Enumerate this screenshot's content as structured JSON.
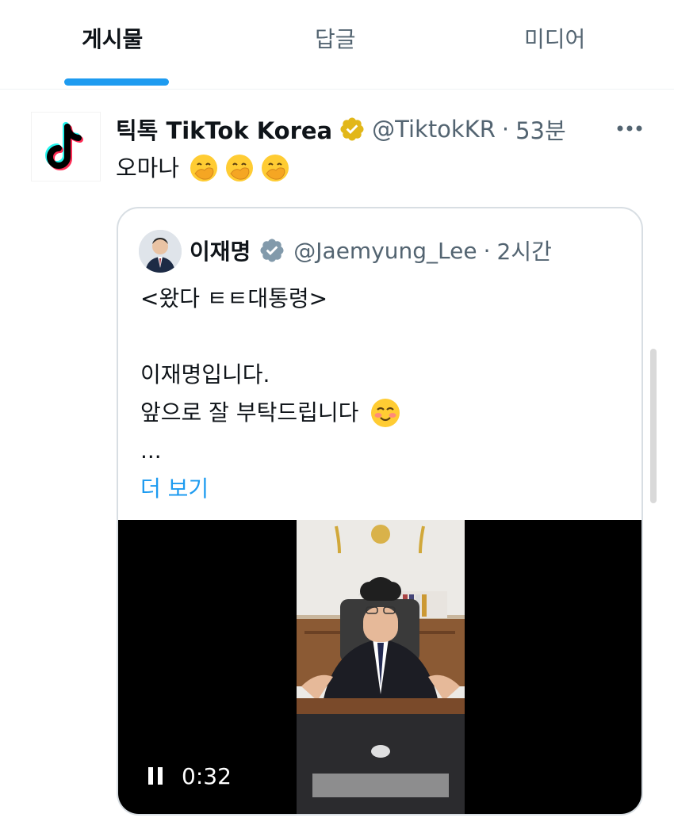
{
  "tabs": [
    {
      "label": "게시물",
      "active": true
    },
    {
      "label": "답글",
      "active": false
    },
    {
      "label": "미디어",
      "active": false
    }
  ],
  "tweet": {
    "author_name": "틱톡 TikTok Korea",
    "handle": "@TiktokKR",
    "separator": "·",
    "time": "53분",
    "text": "오마나",
    "emojis": [
      "face-with-hand-over-mouth",
      "face-with-hand-over-mouth",
      "face-with-hand-over-mouth"
    ],
    "verified_badge": "gold",
    "more_icon": "more-icon"
  },
  "quote": {
    "author_name": "이재명",
    "handle": "@Jaemyung_Lee",
    "separator": "·",
    "time": "2시간",
    "verified_badge": "gray",
    "lines": [
      "<왔다 ㅌㅌ대통령>",
      "",
      "이재명입니다.",
      "앞으로 잘 부탁드립니다",
      "..."
    ],
    "line4_emoji": "smiling-face-with-blush",
    "show_more": "더 보기",
    "video": {
      "duration": "0:32",
      "state": "playing"
    }
  },
  "colors": {
    "accent": "#1d9bf0",
    "text": "#0f1419",
    "secondary": "#536471",
    "gold_badge": "#e2b719",
    "gray_badge": "#829aab"
  }
}
